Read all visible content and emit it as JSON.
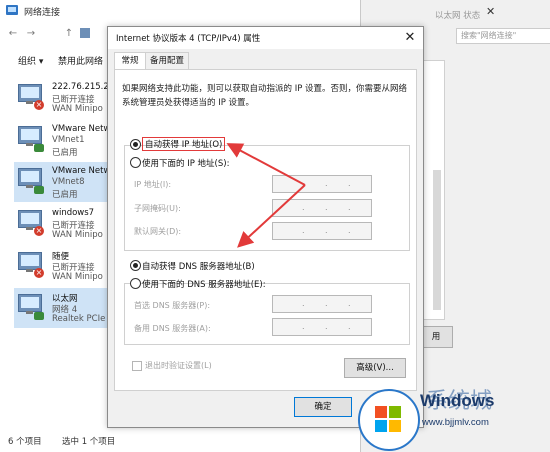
{
  "window": {
    "title": "网络连接"
  },
  "nav": {
    "back": "←",
    "forward": "→",
    "up": "↑"
  },
  "toolbar": {
    "organize": "组织 ▾",
    "disable": "禁用此网络"
  },
  "connections": [
    {
      "name": "222.76.215.21",
      "status": "已断开连接",
      "device": "WAN Minipo",
      "icon": "network-adapter-icon",
      "state": "error"
    },
    {
      "name": "VMware Netw",
      "status": "VMnet1",
      "device": "已启用",
      "icon": "network-adapter-icon",
      "state": "ok"
    },
    {
      "name": "VMware Netw",
      "status": "VMnet8",
      "device": "已启用",
      "icon": "network-adapter-icon",
      "state": "ok",
      "selected": true
    },
    {
      "name": "windows7",
      "status": "已断开连接",
      "device": "WAN Minipo",
      "icon": "network-adapter-icon",
      "state": "error"
    },
    {
      "name": "随便",
      "status": "已断开连接",
      "device": "WAN Minipo",
      "icon": "network-adapter-icon",
      "state": "error"
    },
    {
      "name": "以太网",
      "status": "网络 4",
      "device": "Realtek PCIe",
      "icon": "network-adapter-icon",
      "state": "ok",
      "selected": true
    }
  ],
  "statusbar": {
    "count": "6 个项目",
    "selected": "选中 1 个项目"
  },
  "background_window": {
    "title": "以太网 状态",
    "search_placeholder": "搜索\"网络连接\"",
    "button_partial": "用"
  },
  "dialog": {
    "title": "Internet 协议版本 4 (TCP/IPv4) 属性",
    "close": "✕",
    "tabs": [
      "常规",
      "备用配置"
    ],
    "description": "如果网络支持此功能，则可以获取自动指派的 IP 设置。否则，你需要从网络系统管理员处获得适当的 IP 设置。",
    "ip_auto": "自动获得 IP 地址(O)",
    "ip_manual": "使用下面的 IP 地址(S):",
    "ip_fields": [
      "IP 地址(I):",
      "子网掩码(U):",
      "默认网关(D):"
    ],
    "dns_auto": "自动获得 DNS 服务器地址(B)",
    "dns_manual": "使用下面的 DNS 服务器地址(E):",
    "dns_fields": [
      "首选 DNS 服务器(P):",
      "备用 DNS 服务器(A):"
    ],
    "dot": ".",
    "validate": "退出时验证设置(L)",
    "advanced": "高级(V)...",
    "ok": "确定"
  },
  "watermark": {
    "brand": "Windows",
    "suffix": "系统城",
    "url": "www.bjjmlv.com"
  },
  "colors": {
    "arrow": "#e23a3a",
    "accent": "#0078d7",
    "selection": "#cfe3f6"
  }
}
